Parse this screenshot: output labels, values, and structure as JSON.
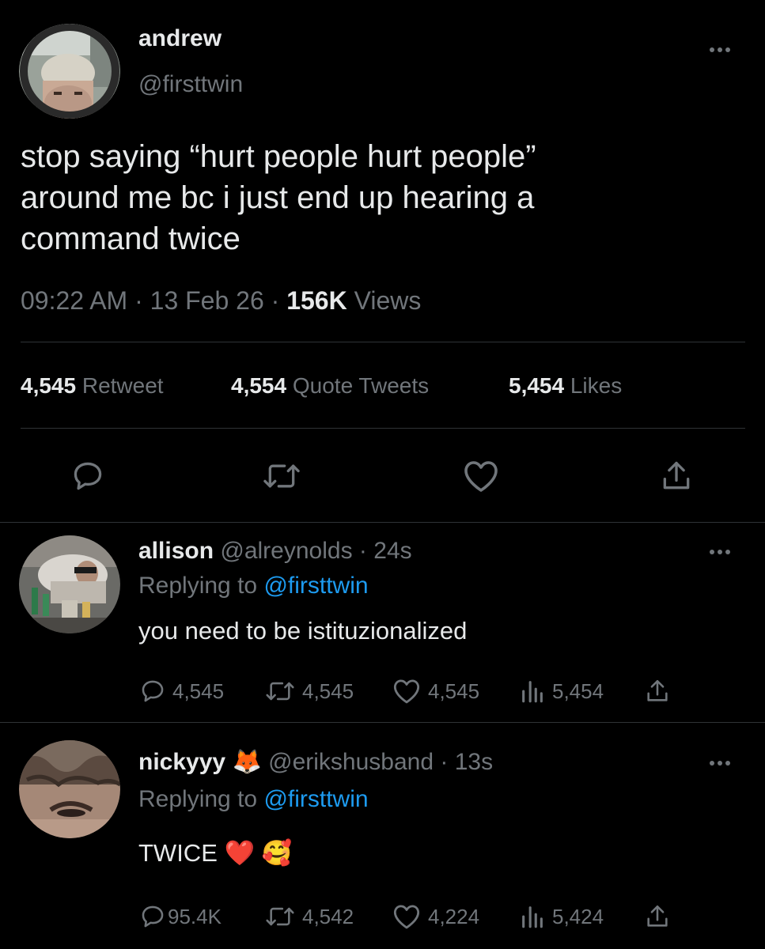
{
  "tweet": {
    "name": "andrew",
    "handle": "@firsttwin",
    "text_lines": [
      "stop saying “hurt people hurt people”",
      "around me bc i just end up hearing a",
      "command twice"
    ],
    "time": "09:22 AM",
    "sep1": "·",
    "date": "13 Feb 26",
    "sep2": "·",
    "views_count": "156K",
    "views_label": "Views",
    "retweets_count": "4,545",
    "retweets_label": "Retweet",
    "quotes_count": "4,554",
    "quotes_label": "Quote Tweets",
    "likes_count": "5,454",
    "likes_label": "Likes"
  },
  "replies": [
    {
      "name": "allison",
      "handle": "@alreynolds",
      "sep": "·",
      "time": "24s",
      "replying_prefix": "Replying to",
      "replying_handle": "@firsttwin",
      "text": "you need to be istituzionalized",
      "replies": "4,545",
      "retweets": "4,545",
      "likes": "4,545",
      "views": "5,454"
    },
    {
      "name": "nickyyy",
      "name_emoji": "🦊",
      "handle": "@erikshusband",
      "sep": "·",
      "time": "13s",
      "replying_prefix": "Replying to",
      "replying_handle": "@firsttwin",
      "text": "TWICE",
      "text_emoji": "❤️ 🥰",
      "replies": "95.4K",
      "retweets": "4,542",
      "likes": "4,224",
      "views": "5,424"
    }
  ],
  "colors": {
    "background": "#000000",
    "text": "#e7e9ea",
    "secondary": "#71767b",
    "accent": "#1d9bf0",
    "divider": "#2f3336"
  },
  "icons": [
    "more-icon",
    "reply-icon",
    "retweet-icon",
    "like-icon",
    "share-icon",
    "views-icon"
  ]
}
